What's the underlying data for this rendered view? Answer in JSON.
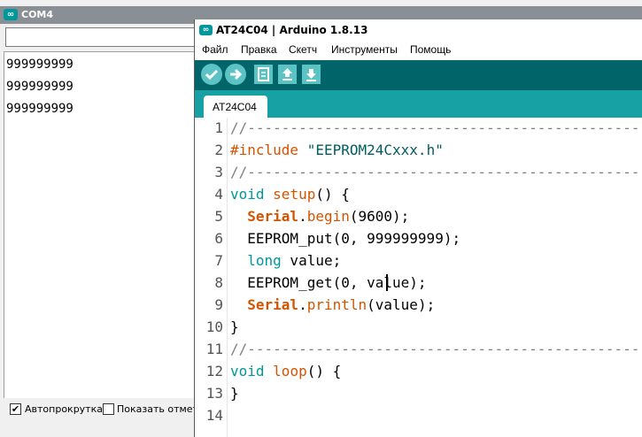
{
  "serial_monitor": {
    "title": "COM4",
    "send_input_value": "",
    "output_lines": [
      "999999999",
      "999999999",
      "999999999"
    ],
    "autoscroll_label": "Автопрокрутка",
    "autoscroll_checked": "✔",
    "timestamp_label": "Показать отметк"
  },
  "ide": {
    "title": "AT24C04 | Arduino 1.8.13",
    "menu": [
      "Файл",
      "Правка",
      "Скетч",
      "Инструменты",
      "Помощь"
    ],
    "toolbar_icons": [
      "verify-icon",
      "upload-icon",
      "new-sketch-icon",
      "open-sketch-icon",
      "save-sketch-icon"
    ],
    "tab_label": "AT24C04",
    "line_numbers": [
      "1",
      "2",
      "3",
      "4",
      "5",
      "6",
      "7",
      "8",
      "9",
      "10",
      "11",
      "12",
      "13",
      "14"
    ],
    "code": {
      "l1": "//----------------------------------------------",
      "l2_directive": "#include",
      "l2_string": "\"EEPROM24Cxxx.h\"",
      "l3": "//----------------------------------------------",
      "l4_type": "void",
      "l4_func": "setup",
      "l4_rest": "() {",
      "l5_obj": "Serial",
      "l5_dot": ".",
      "l5_method": "begin",
      "l5_rest": "(9600);",
      "l6": "EEPROM_put(0, 999999999);",
      "l7_type": "long",
      "l7_rest": " value;",
      "l8_before": "EEPROM_get(0, ",
      "l8_after": "value);",
      "l9_obj": "Serial",
      "l9_dot": ".",
      "l9_method": "println",
      "l9_rest": "(value);",
      "l10": "}",
      "l11": "//----------------------------------------------",
      "l12_type": "void",
      "l12_func": "loop",
      "l12_rest": "() {",
      "l13": "}"
    }
  },
  "colors": {
    "ide_toolbar": "#006468",
    "ide_tabbar": "#17a1a5",
    "toolbar_button": "#5cc3c4",
    "keyword_teal": "#00979c",
    "keyword_orange": "#d35400",
    "serial_titlebar": "#8a8f96"
  }
}
